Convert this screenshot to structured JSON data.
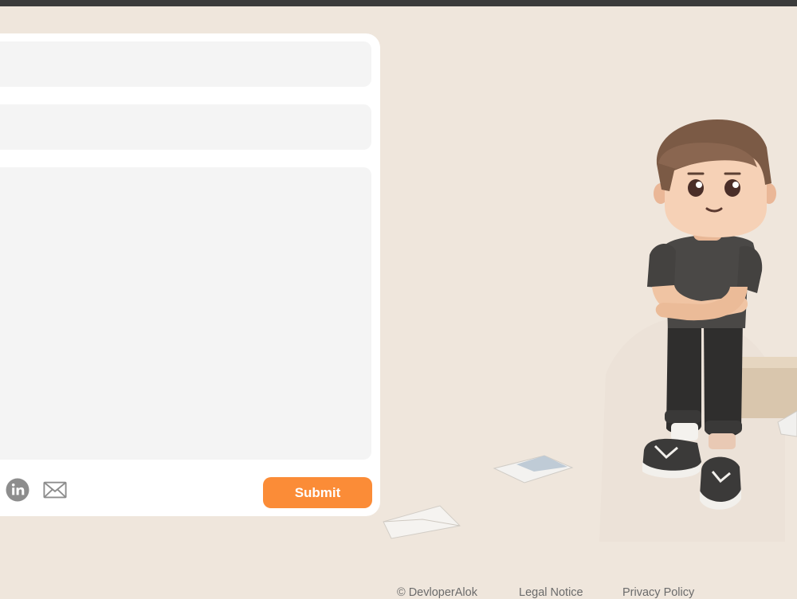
{
  "form": {
    "submit_label": "Submit"
  },
  "social": {
    "linkedin_icon": "linkedin-icon",
    "mail_icon": "mail-icon"
  },
  "footer": {
    "copyright": "© DevloperAlok",
    "legal": "Legal Notice",
    "privacy": "Privacy Policy"
  },
  "colors": {
    "background": "#efe6dc",
    "accent": "#fb8c37",
    "card": "#ffffff",
    "field": "#f4f4f4",
    "topbar": "#3b3b3b"
  }
}
